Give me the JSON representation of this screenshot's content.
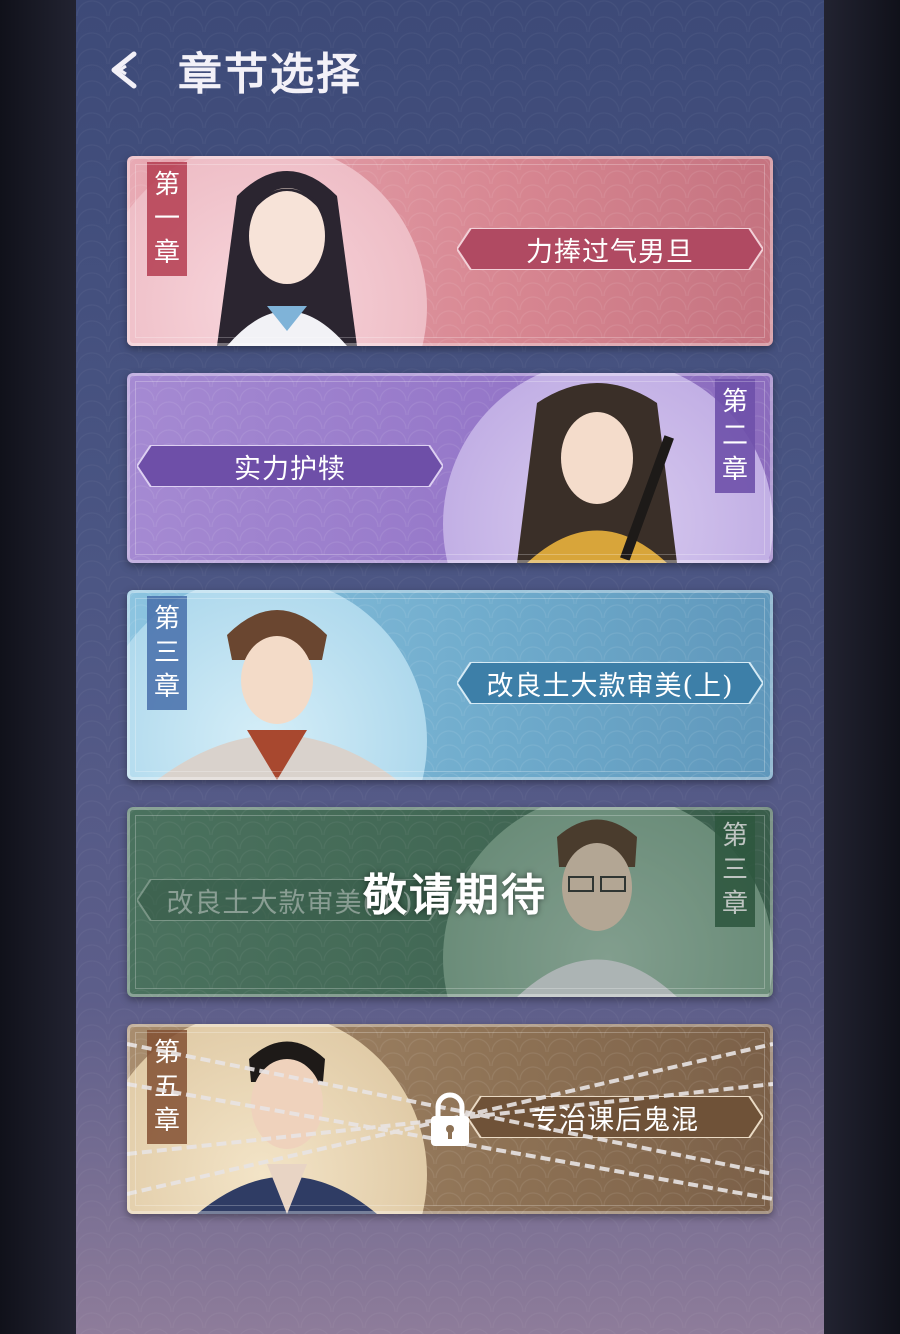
{
  "header": {
    "title": "章节选择"
  },
  "chapters": [
    {
      "tag": [
        "第",
        "一",
        "章"
      ],
      "title": "力捧过气男旦",
      "state": "unlocked",
      "color": "#d78691"
    },
    {
      "tag": [
        "第",
        "二",
        "章"
      ],
      "title": "实力护犊",
      "state": "unlocked",
      "color": "#9476c8"
    },
    {
      "tag": [
        "第",
        "三",
        "章"
      ],
      "title": "改良土大款审美(上)",
      "state": "unlocked",
      "color": "#6eaacb"
    },
    {
      "tag": [
        "第",
        "三",
        "章"
      ],
      "title": "改良土大款审美(下)",
      "state": "coming_soon",
      "overlay": "敬请期待",
      "color": "#4c7962"
    },
    {
      "tag": [
        "第",
        "五",
        "章"
      ],
      "title": "专治课后鬼混",
      "state": "locked",
      "color": "#8d7154"
    }
  ]
}
